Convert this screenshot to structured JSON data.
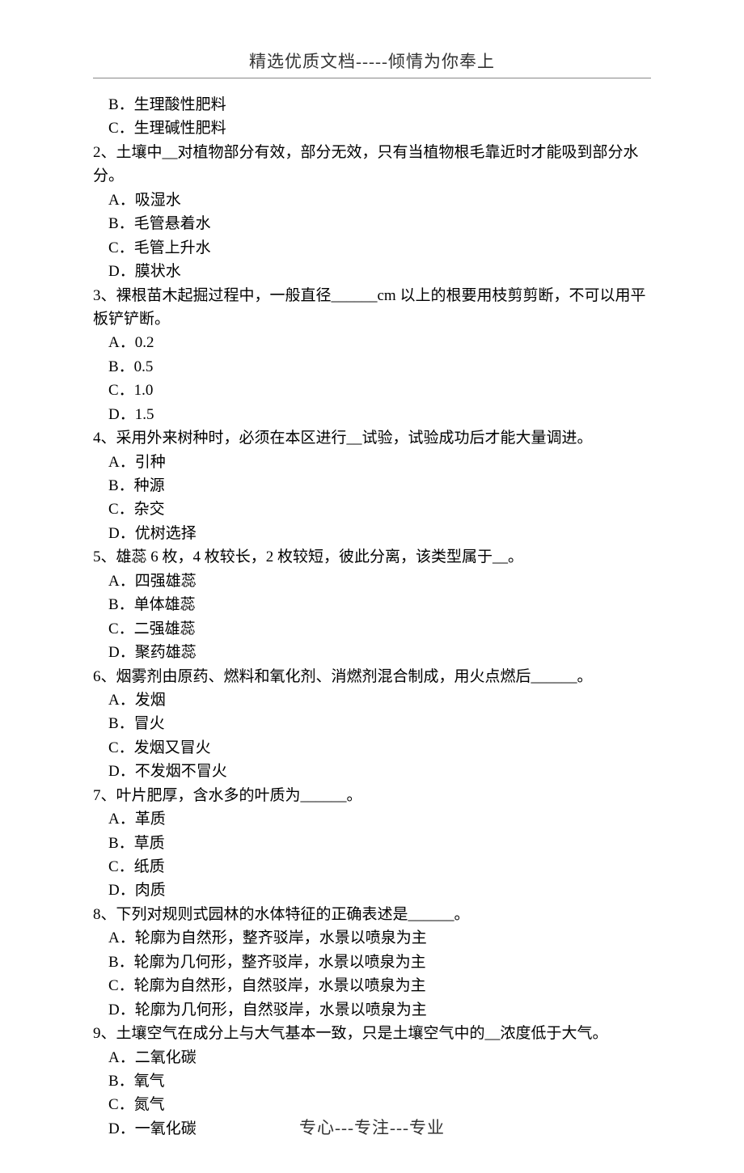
{
  "header": "精选优质文档-----倾情为你奉上",
  "footer": "专心---专注---专业",
  "pre_options": [
    "B．生理酸性肥料",
    "C．生理碱性肥料"
  ],
  "questions": [
    {
      "stem": "2、土壤中__对植物部分有效，部分无效，只有当植物根毛靠近时才能吸到部分水分。",
      "options": [
        "A．吸湿水",
        "B．毛管悬着水",
        "C．毛管上升水",
        "D．膜状水"
      ]
    },
    {
      "stem": "3、裸根苗木起掘过程中，一般直径______cm 以上的根要用枝剪剪断，不可以用平板铲铲断。",
      "options": [
        "A．0.2",
        "B．0.5",
        "C．1.0",
        "D．1.5"
      ]
    },
    {
      "stem": "4、采用外来树种时，必须在本区进行__试验，试验成功后才能大量调进。",
      "options": [
        "A．引种",
        "B．种源",
        "C．杂交",
        "D．优树选择"
      ]
    },
    {
      "stem": "5、雄蕊 6 枚，4 枚较长，2 枚较短，彼此分离，该类型属于__。",
      "options": [
        "A．四强雄蕊",
        "B．单体雄蕊",
        "C．二强雄蕊",
        "D．聚药雄蕊"
      ]
    },
    {
      "stem": "6、烟雾剂由原药、燃料和氧化剂、消燃剂混合制成，用火点燃后______。",
      "options": [
        "A．发烟",
        "B．冒火",
        "C．发烟又冒火",
        "D．不发烟不冒火"
      ]
    },
    {
      "stem": "7、叶片肥厚，含水多的叶质为______。",
      "options": [
        "A．革质",
        "B．草质",
        "C．纸质",
        "D．肉质"
      ]
    },
    {
      "stem": "8、下列对规则式园林的水体特征的正确表述是______。",
      "options": [
        "A．轮廓为自然形，整齐驳岸，水景以喷泉为主",
        "B．轮廓为几何形，整齐驳岸，水景以喷泉为主",
        "C．轮廓为自然形，自然驳岸，水景以喷泉为主",
        "D．轮廓为几何形，自然驳岸，水景以喷泉为主"
      ]
    },
    {
      "stem": "9、土壤空气在成分上与大气基本一致，只是土壤空气中的__浓度低于大气。",
      "options": [
        "A．二氧化碳",
        "B．氧气",
        "C．氮气",
        "D．一氧化碳"
      ]
    }
  ]
}
